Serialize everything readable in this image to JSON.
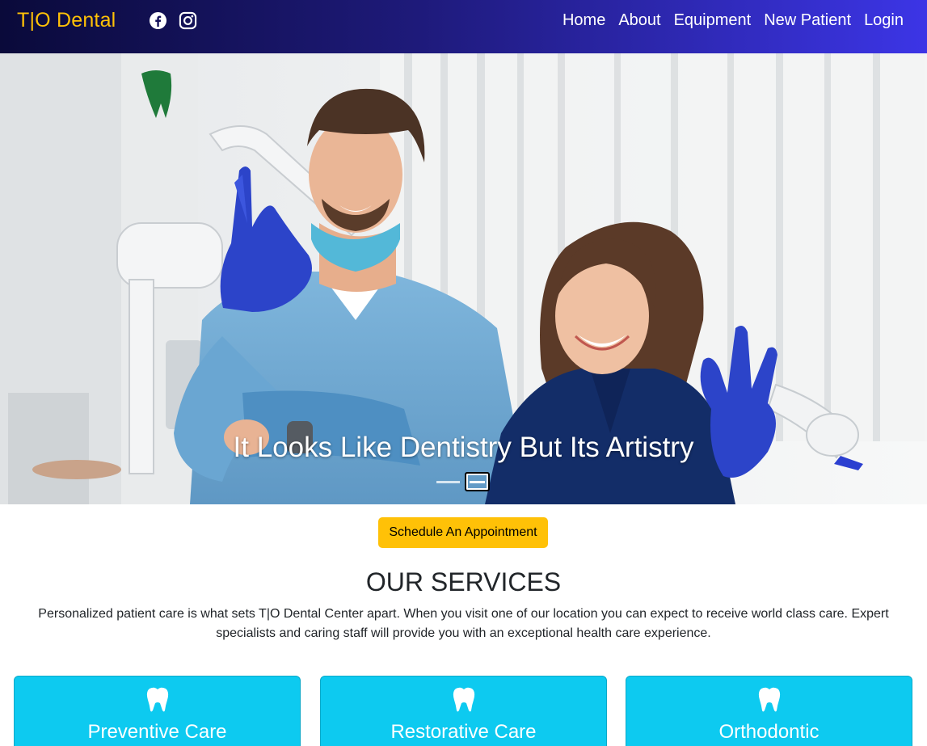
{
  "navbar": {
    "brand": "T|O Dental",
    "social": [
      {
        "icon": "facebook-icon"
      },
      {
        "icon": "instagram-icon"
      }
    ],
    "links": [
      "Home",
      "About",
      "Equipment",
      "New Patient",
      "Login"
    ],
    "colors": {
      "brand": "#ffc107",
      "gradient_start": "#0a0a3a",
      "gradient_end": "#3c35e6"
    }
  },
  "hero": {
    "caption": "It Looks Like Dentistry But Its Artistry",
    "slide_count": 2,
    "active_slide": 2
  },
  "cta": {
    "label": "Schedule An Appointment",
    "color": "#ffc107"
  },
  "services": {
    "title": "OUR SERVICES",
    "description": "Personalized patient care is what sets T|O Dental Center apart. When you visit one of our location you can expect to receive world class care. Expert specialists and caring staff will provide you with an exceptional health care experience.",
    "card_color": "#0dcaf0",
    "cards": [
      {
        "icon": "tooth-icon",
        "title": "Preventive Care"
      },
      {
        "icon": "tooth-icon",
        "title": "Restorative Care"
      },
      {
        "icon": "tooth-icon",
        "title": "Orthodontic"
      }
    ]
  }
}
